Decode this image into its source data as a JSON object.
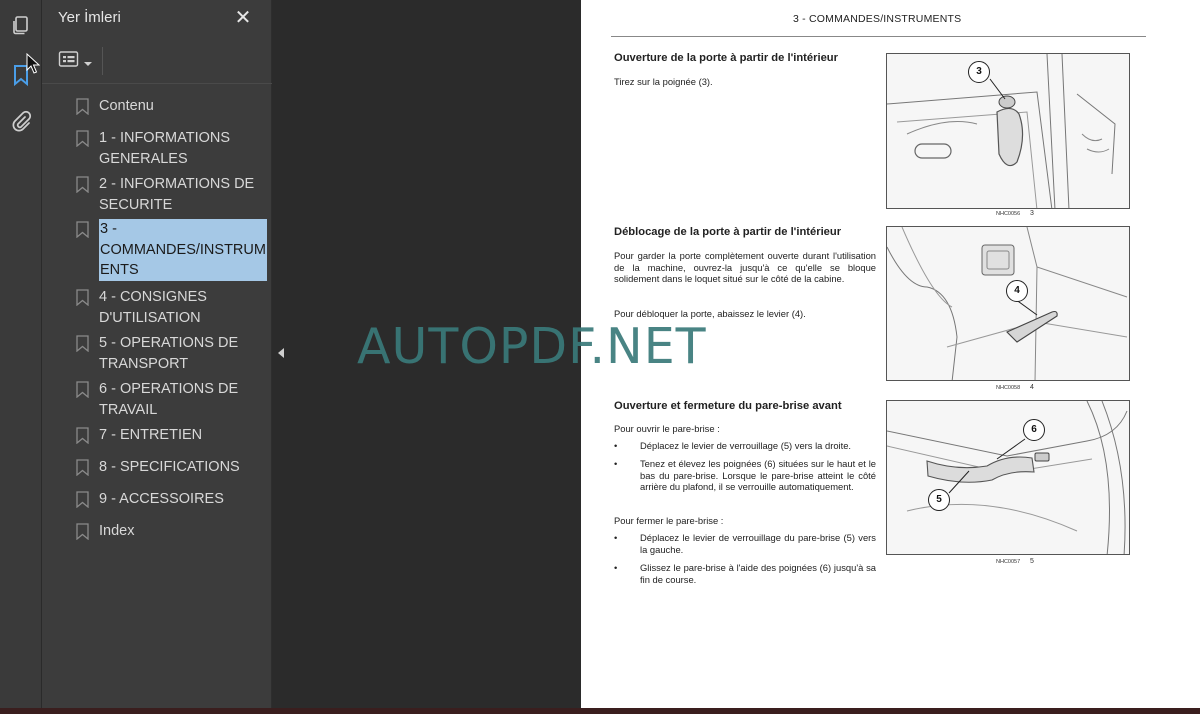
{
  "panel": {
    "title": "Yer İmleri",
    "close_symbol": "✕"
  },
  "bookmarks": [
    {
      "label": "Contenu"
    },
    {
      "label": "1 - INFORMATIONS GENERALES"
    },
    {
      "label": "2 - INFORMATIONS DE SECURITE"
    },
    {
      "label": "3 - COMMANDES/INSTRUMENTS",
      "selected": true
    },
    {
      "label": "4 - CONSIGNES D'UTILISATION"
    },
    {
      "label": "5 - OPERATIONS DE TRANSPORT"
    },
    {
      "label": "6 - OPERATIONS DE TRAVAIL"
    },
    {
      "label": "7 - ENTRETIEN"
    },
    {
      "label": "8 - SPECIFICATIONS"
    },
    {
      "label": "9 - ACCESSOIRES"
    },
    {
      "label": "Index"
    }
  ],
  "watermark": "AUTOPDF.NET",
  "page": {
    "header": "3 - COMMANDES/INSTRUMENTS",
    "sections": [
      {
        "title": "Ouverture de la porte à partir de l'intérieur",
        "paragraphs": [
          "Tirez sur la poignée (3)."
        ],
        "figure": {
          "code": "NHC0056",
          "number": "3",
          "callouts": [
            "3"
          ]
        }
      },
      {
        "title": "Déblocage de la porte à partir de l'intérieur",
        "paragraphs": [
          "Pour garder la porte complètement ouverte durant l'utilisation de la machine, ouvrez-la jusqu'à ce qu'elle se bloque solidement dans le loquet situé sur le côté de la cabine.",
          "Pour débloquer la porte, abaissez le levier (4)."
        ],
        "figure": {
          "code": "NHC0058",
          "number": "4",
          "callouts": [
            "4"
          ]
        }
      },
      {
        "title": "Ouverture et fermeture du pare-brise avant",
        "open_intro": "Pour ouvrir le pare-brise :",
        "open_steps": [
          "Déplacez le levier de verrouillage (5) vers la droite.",
          "Tenez et élevez les poignées (6) situées sur le haut et le bas du pare-brise. Lorsque le pare-brise atteint le côté arrière du plafond, il se verrouille automatiquement."
        ],
        "close_intro": "Pour fermer le pare-brise :",
        "close_steps": [
          "Déplacez le levier de verrouillage du pare-brise (5) vers la gauche.",
          "Glissez le pare-brise à l'aide des poignées (6) jusqu'à sa fin de course."
        ],
        "figure": {
          "code": "NHC0057",
          "number": "5",
          "callouts": [
            "6",
            "5"
          ]
        }
      }
    ]
  },
  "icons": {
    "pages": "pages-icon",
    "bookmarks": "bookmark-icon",
    "attachments": "paperclip-icon",
    "options": "options-menu-icon",
    "collapse": "collapse-arrow-icon"
  },
  "colors": {
    "selected_bookmark": "#a5c8e6",
    "watermark": "#3a7a7a",
    "active_rail_icon": "#4a9ee8"
  }
}
